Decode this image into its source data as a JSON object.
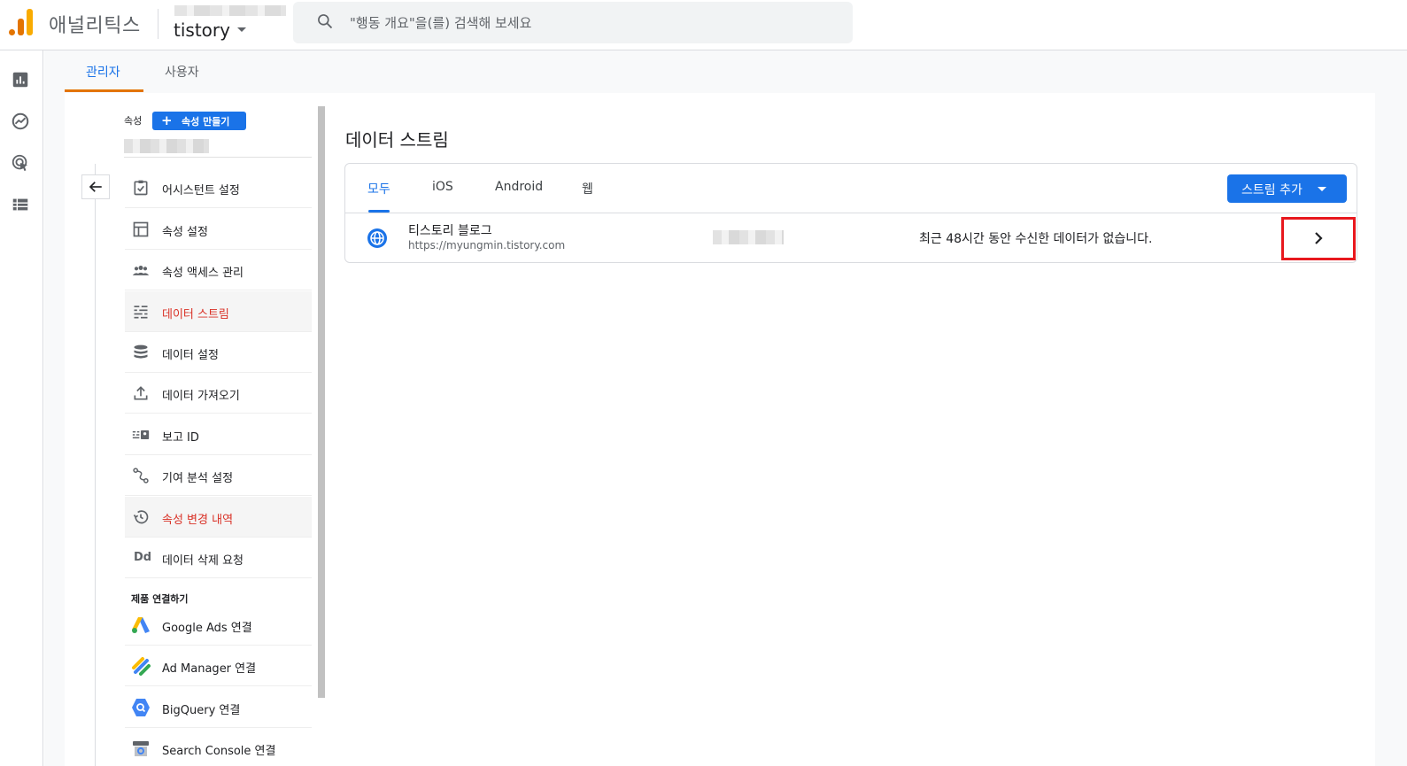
{
  "header": {
    "app_name": "애널리틱스",
    "account_name": "tistory",
    "search_placeholder": "\"행동 개요\"을(를) 검색해 보세요"
  },
  "top_tabs": [
    {
      "label": "관리자",
      "active": true
    },
    {
      "label": "사용자",
      "active": false
    }
  ],
  "property": {
    "label": "속성",
    "create_button": "속성 만들기"
  },
  "nav_items": [
    {
      "label": "어시스턴트 설정",
      "icon": "checklist-icon"
    },
    {
      "label": "속성 설정",
      "icon": "layout-icon"
    },
    {
      "label": "속성 액세스 관리",
      "icon": "people-icon"
    },
    {
      "label": "데이터 스트림",
      "icon": "streams-icon",
      "active": true
    },
    {
      "label": "데이터 설정",
      "icon": "database-icon"
    },
    {
      "label": "데이터 가져오기",
      "icon": "upload-icon"
    },
    {
      "label": "보고 ID",
      "icon": "id-icon"
    },
    {
      "label": "기여 분석 설정",
      "icon": "attribution-icon"
    },
    {
      "label": "속성 변경 내역",
      "icon": "history-icon",
      "active": true
    },
    {
      "label": "데이터 삭제 요청",
      "icon": "dd-icon"
    }
  ],
  "product_links": {
    "label": "제품 연결하기",
    "items": [
      {
        "label": "Google Ads 연결",
        "icon": "google-ads-icon"
      },
      {
        "label": "Ad Manager 연결",
        "icon": "ad-manager-icon"
      },
      {
        "label": "BigQuery 연결",
        "icon": "bigquery-icon"
      },
      {
        "label": "Search Console 연결",
        "icon": "search-console-icon"
      }
    ]
  },
  "main": {
    "title": "데이터 스트림",
    "tabs": [
      {
        "label": "모두",
        "active": true
      },
      {
        "label": "iOS"
      },
      {
        "label": "Android"
      },
      {
        "label": "웹"
      }
    ],
    "add_stream_button": "스트림 추가",
    "streams": [
      {
        "name": "티스토리 블로그",
        "url": "https://myungmin.tistory.com",
        "status": "최근 48시간 동안 수신한 데이터가 없습니다."
      }
    ]
  },
  "colors": {
    "accent_blue": "#1a73e8",
    "tab_underline_orange": "#e37400",
    "highlight_red": "#e8181e",
    "active_red_text": "#d93025"
  }
}
